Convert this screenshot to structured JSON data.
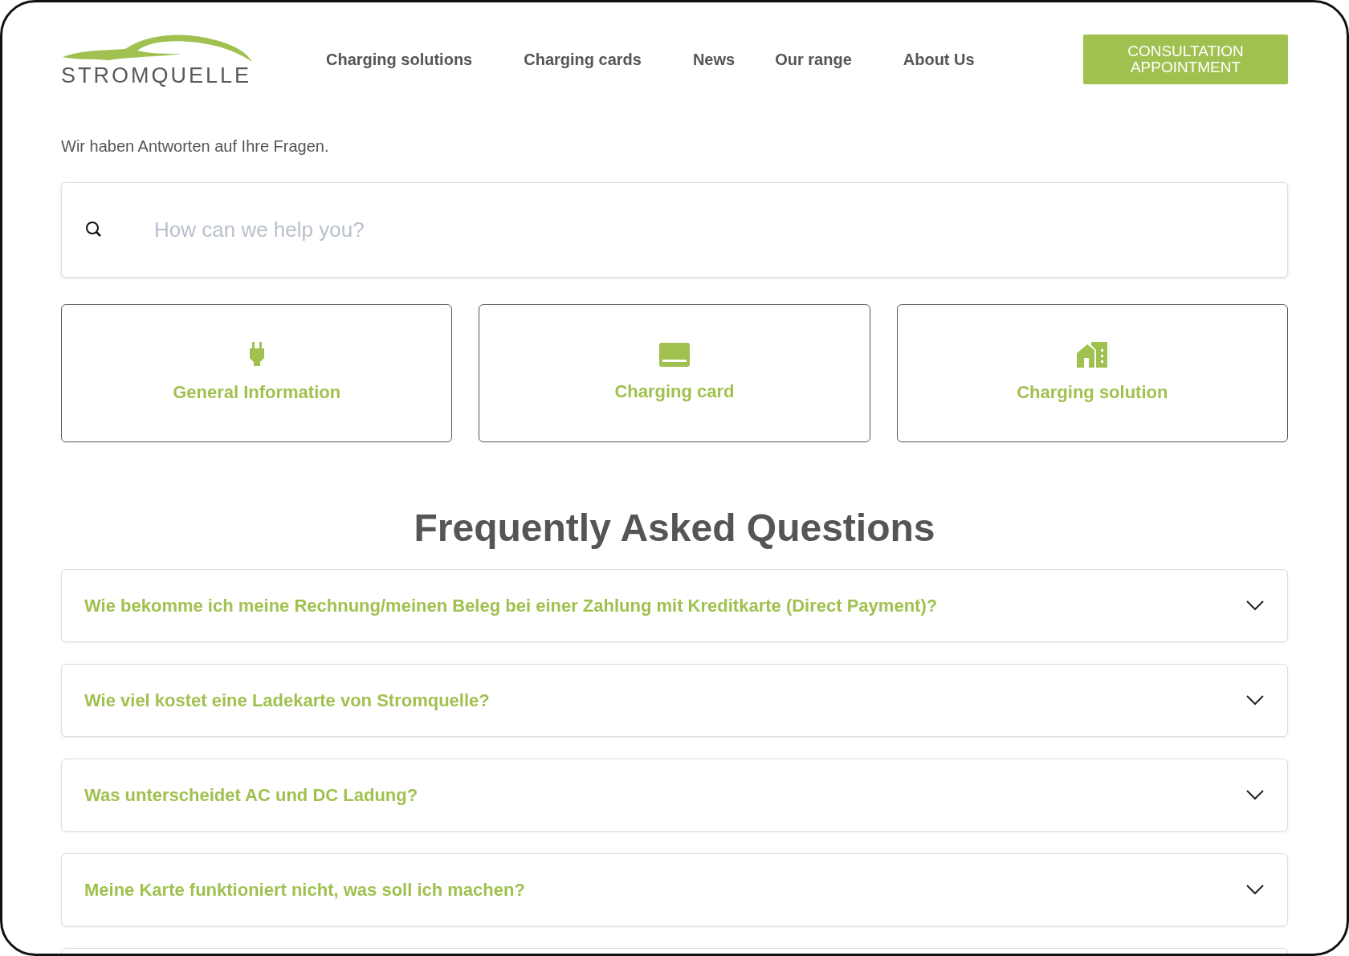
{
  "header": {
    "logo_text": "STROMQUELLE",
    "nav": [
      "Charging solutions",
      "Charging cards",
      "News",
      "Our range",
      "About Us"
    ],
    "cta": "CONSULTATION APPOINTMENT"
  },
  "intro": "Wir haben Antworten auf Ihre Fragen.",
  "search": {
    "placeholder": "How can we help you?"
  },
  "categories": [
    {
      "label": "General Information",
      "kind": "plug"
    },
    {
      "label": "Charging card",
      "kind": "card"
    },
    {
      "label": "Charging solution",
      "kind": "house"
    }
  ],
  "faq": {
    "title": "Frequently Asked Questions",
    "items": [
      {
        "question": "Wie bekomme ich meine Rechnung/meinen Beleg bei einer Zahlung mit Kreditkarte (Direct Payment)?",
        "expanded": false
      },
      {
        "question": "Wie viel kostet eine Ladekarte von Stromquelle?",
        "expanded": false
      },
      {
        "question": "Was unterscheidet AC und DC Ladung?",
        "expanded": false
      },
      {
        "question": "Meine Karte funktioniert nicht, was soll ich machen?",
        "expanded": false
      }
    ]
  }
}
